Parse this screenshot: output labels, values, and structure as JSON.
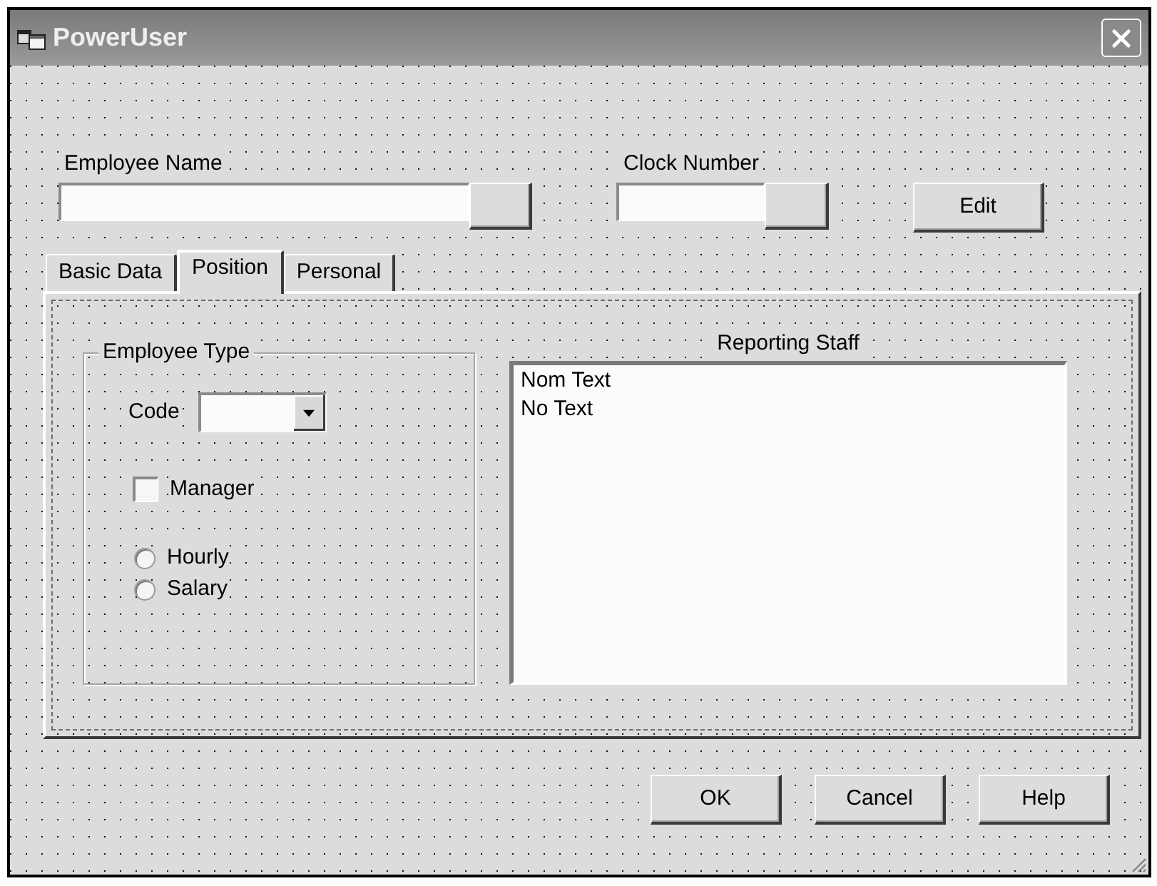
{
  "window": {
    "title": "PowerUser"
  },
  "employee_name": {
    "label": "Employee Name"
  },
  "clock_number": {
    "label": "Clock Number"
  },
  "edit_button": "Edit",
  "tabs": [
    {
      "label": "Basic Data",
      "selected": false
    },
    {
      "label": "Position",
      "selected": true
    },
    {
      "label": "Personal",
      "selected": false
    }
  ],
  "employee_type": {
    "title": "Employee Type",
    "code_label": "Code",
    "manager": {
      "label": "Manager",
      "checked": false
    },
    "pay_basis": [
      {
        "label": "Hourly",
        "selected": false
      },
      {
        "label": "Salary",
        "selected": false
      }
    ]
  },
  "reporting_staff": {
    "title": "Reporting Staff",
    "items": [
      "Nom Text",
      "No Text"
    ]
  },
  "buttons": [
    "OK",
    "Cancel",
    "Help"
  ]
}
